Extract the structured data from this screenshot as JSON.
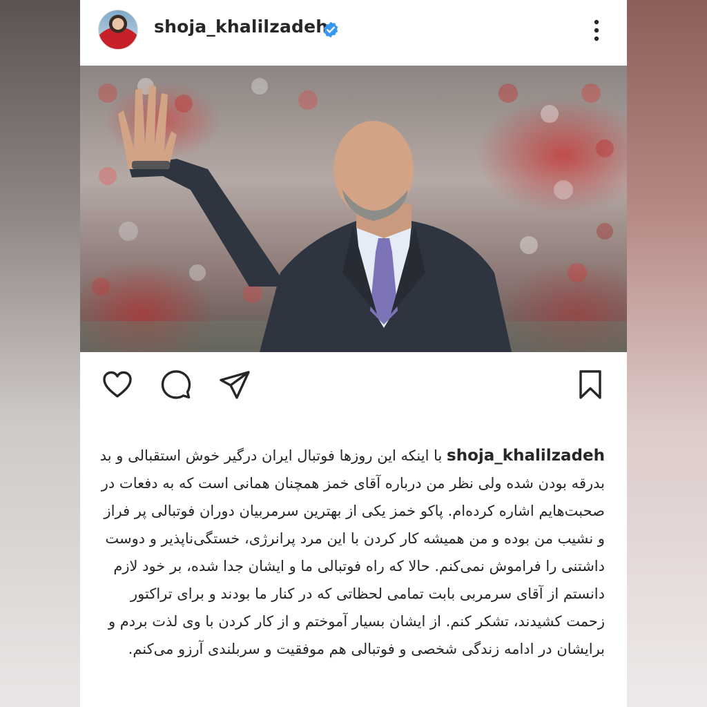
{
  "post": {
    "username": "shoja_khalilzadeh",
    "verified": true,
    "icons": {
      "avatar": "profile-avatar",
      "verified": "verified-badge-icon",
      "more": "more-options-icon",
      "like": "heart-icon",
      "comment": "comment-icon",
      "share": "send-icon",
      "save": "bookmark-icon"
    },
    "image": {
      "description_icon": "photo-coach-waving-stadium"
    },
    "caption": {
      "username": "shoja_khalilzadeh",
      "text": "با اینکه این روزها فوتبال ایران درگیر خوش استقبالی و بد بدرقه بودن شده ولی نظر من درباره آقای خمز همچنان همانی است که به دفعات در صحبت‌هایم اشاره کرده‌ام. پاکو خمز یکی از بهترین سرمربیان دوران فوتبالی پر فراز و نشیب من بوده و من همیشه کار کردن با این مرد پرانرژی، خستگی‌ناپذیر و دوست داشتنی را فراموش نمی‌کنم. حالا که راه فوتبالی ما و ایشان جدا شده، بر خود لازم دانستم از آقای سرمربی بابت تمامی لحظاتی که در کنار ما بودند و برای تراکتور زحمت کشیدند، تشکر کنم. از ایشان بسیار آموختم و از کار کردن با وی لذت بردم و برایشان در ادامه زندگی شخصی و فوتبالی هم موفقیت و سربلندی آرزو می‌کنم."
    }
  },
  "colors": {
    "verified": "#3897f0",
    "text": "#262626",
    "card": "#ffffff"
  }
}
